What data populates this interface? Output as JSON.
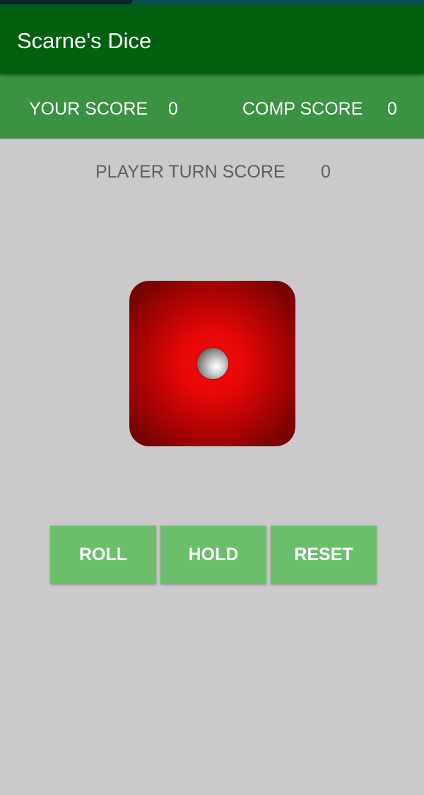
{
  "app": {
    "title": "Scarne's Dice"
  },
  "scoreboard": {
    "your_score_label": "YOUR SCORE",
    "your_score_value": "0",
    "comp_score_label": "COMP SCORE",
    "comp_score_value": "0"
  },
  "turn": {
    "label": "PLAYER TURN SCORE",
    "value": "0"
  },
  "die": {
    "face_value": 1,
    "color": "#e50707"
  },
  "buttons": {
    "roll": "ROLL",
    "hold": "HOLD",
    "reset": "RESET"
  },
  "colors": {
    "app_bar": "#03600f",
    "score_bar": "#3a9242",
    "button": "#6bbf6b",
    "background": "#cbc9cb"
  }
}
